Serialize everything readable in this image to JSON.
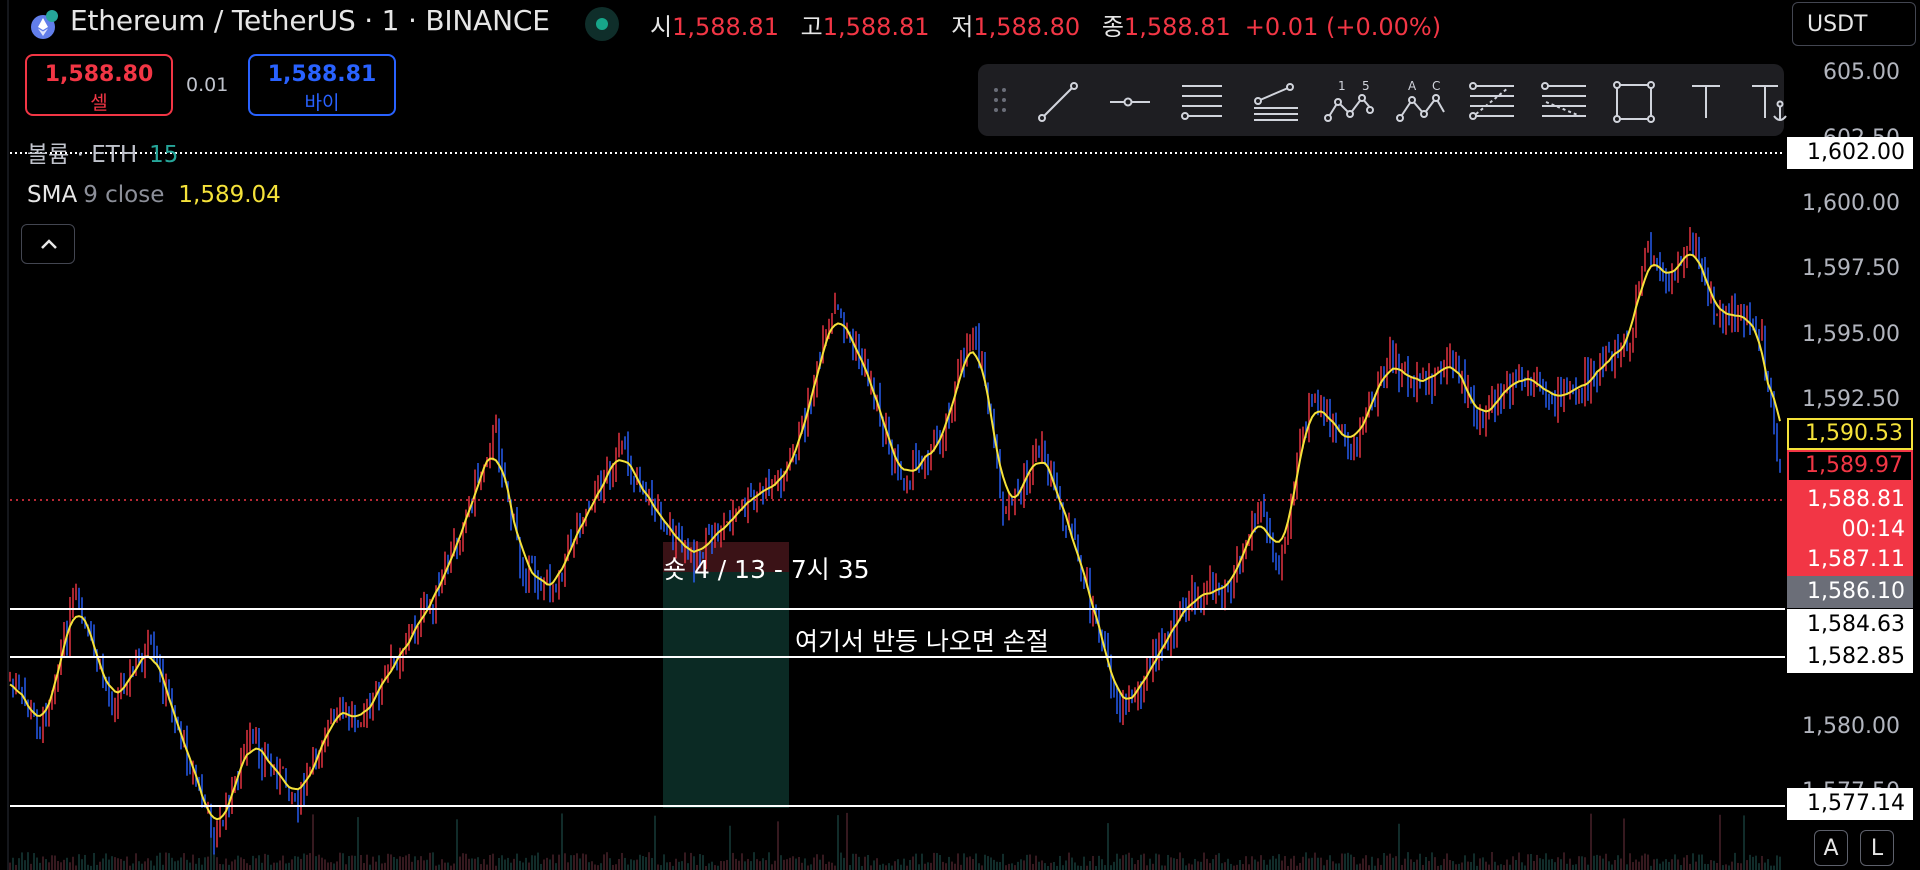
{
  "header": {
    "title": "Ethereum / TetherUS · 1 · BINANCE",
    "ohlc": [
      {
        "label": "시",
        "value": "1,588.81"
      },
      {
        "label": "고",
        "value": "1,588.81"
      },
      {
        "label": "저",
        "value": "1,588.80"
      },
      {
        "label": "종",
        "value": "1,588.81"
      }
    ],
    "change": "+0.01 (+0.00%)",
    "currency": "USDT"
  },
  "trade": {
    "sell_price": "1,588.80",
    "sell_label": "셀",
    "spread": "0.01",
    "buy_price": "1,588.81",
    "buy_label": "바이"
  },
  "legends": {
    "volume_name": "볼륨 · ETH",
    "volume_value": "15",
    "sma_name": "SMA",
    "sma_params": "9 close",
    "sma_value": "1,589.04"
  },
  "toolbar": {
    "tools": [
      "drag-handle",
      "trend-line",
      "horizontal-ray",
      "parallel-channel",
      "pitchfork",
      "xabcd-pattern",
      "abcd-pattern",
      "fib-retracement",
      "fib-extension",
      "rectangle",
      "text",
      "anchored-text"
    ],
    "labels": {
      "pattern1_a": "1",
      "pattern1_b": "5",
      "pattern2_a": "A",
      "pattern2_b": "C"
    }
  },
  "price_scale": {
    "ticks": [
      "605.00",
      "602.50",
      "1,600.00",
      "1,597.50",
      "1,595.00",
      "1,592.50",
      "1,580.00",
      "1,577.50"
    ],
    "tags": {
      "line_top": "1,602.00",
      "sma": "1,590.53",
      "red1": "1,589.97",
      "live_price": "1,588.81",
      "countdown": "00:14",
      "red2": "1,587.11",
      "gray": "1,586.10",
      "line1": "1,584.63",
      "line2": "1,582.85",
      "line3": "1,577.14"
    }
  },
  "annotations": {
    "entry": "숏 4 / 13 - 7시 35",
    "note": "여기서 반등 나오면 손절"
  },
  "corner_buttons": {
    "auto": "A",
    "log": "L"
  },
  "colors": {
    "up": "#f23645",
    "down": "#2962ff",
    "sma": "#f5e23a",
    "volume": "#26a69a",
    "background": "#000000"
  }
}
